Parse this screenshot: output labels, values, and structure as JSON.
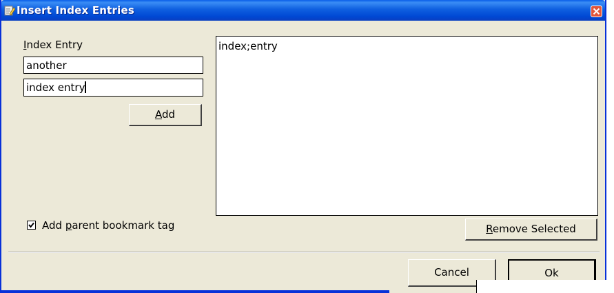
{
  "window": {
    "title": "Insert Index Entries"
  },
  "left_panel": {
    "index_entry_label_first": "I",
    "index_entry_label_rest": "ndex Entry",
    "field1_value": "another",
    "field2_value": "index entry",
    "add_button_first": "A",
    "add_button_rest": "dd"
  },
  "list": {
    "items": [
      "index;entry"
    ]
  },
  "checkbox": {
    "label_before": "Add ",
    "label_accel": "p",
    "label_after": "arent bookmark tag",
    "checked": true
  },
  "buttons": {
    "remove_first": "R",
    "remove_rest": "emove Selected",
    "cancel": "Cancel",
    "ok": "Ok"
  }
}
